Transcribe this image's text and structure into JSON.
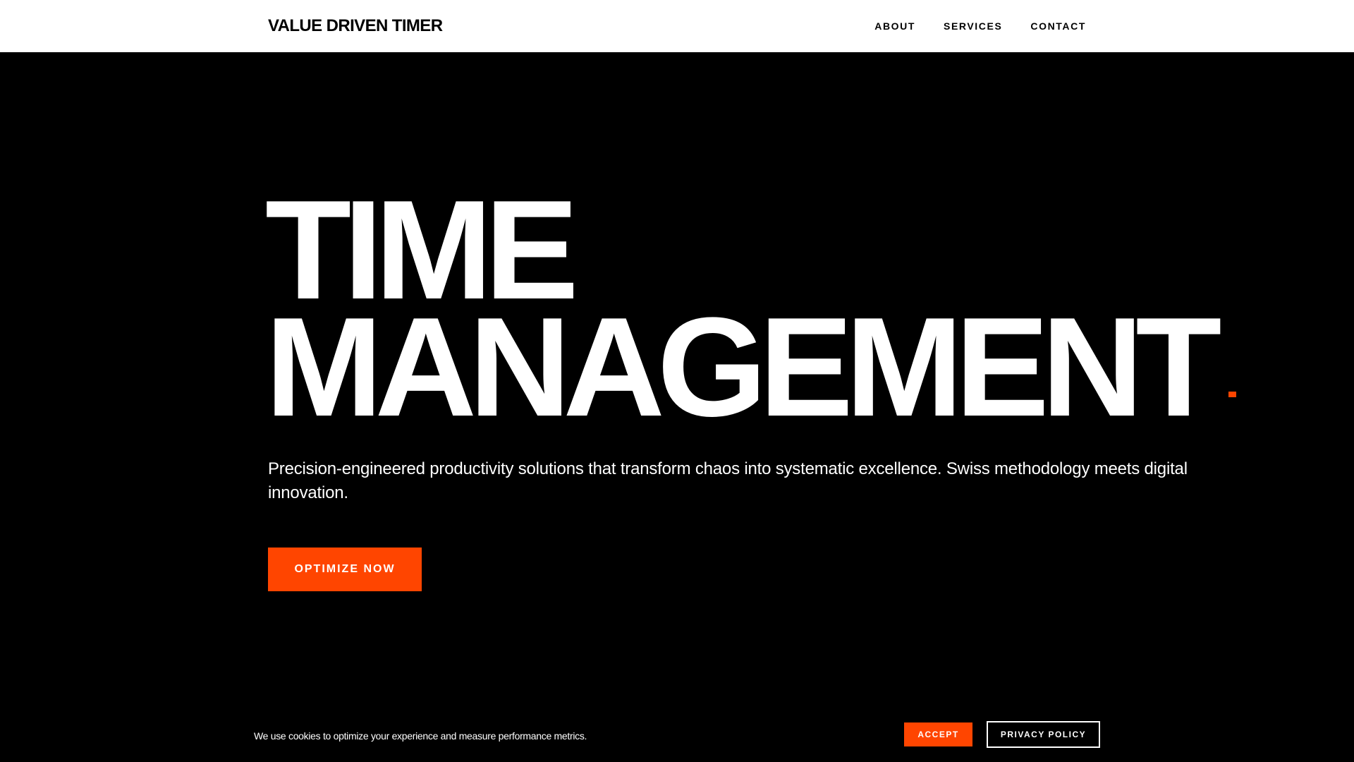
{
  "header": {
    "logo": "VALUE DRIVEN TIMER",
    "nav": [
      {
        "label": "ABOUT"
      },
      {
        "label": "SERVICES"
      },
      {
        "label": "CONTACT"
      }
    ]
  },
  "hero": {
    "title_line_1": "TIME",
    "title_line_2": "MANAGEMENT",
    "subtitle": "Precision-engineered productivity solutions that transform chaos into systematic excellence. Swiss methodology meets digital innovation.",
    "cta_label": "OPTIMIZE NOW"
  },
  "cookie_banner": {
    "message": "We use cookies to optimize your experience and measure performance metrics.",
    "accept_label": "ACCEPT",
    "privacy_label": "PRIVACY POLICY"
  },
  "colors": {
    "accent": "#ff4500",
    "background": "#000000",
    "header_background": "#ffffff",
    "text_light": "#ffffff",
    "text_dark": "#000000"
  }
}
